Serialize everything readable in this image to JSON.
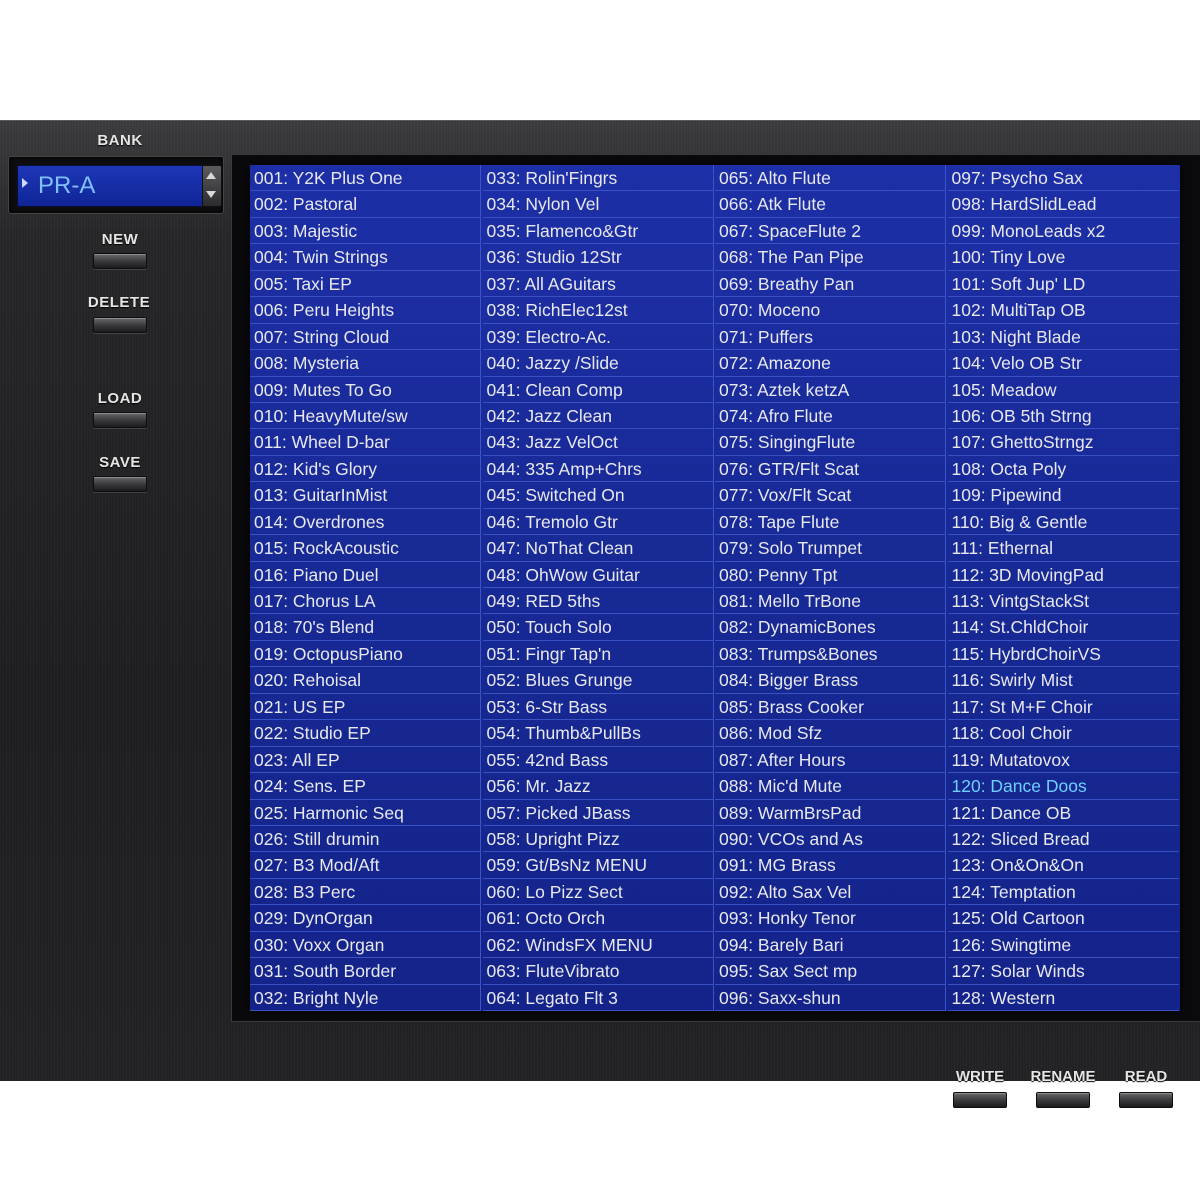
{
  "bank": {
    "label": "BANK",
    "value": "PR-A"
  },
  "side_buttons": {
    "new": "NEW",
    "delete": "DELETE",
    "load": "LOAD",
    "save": "SAVE"
  },
  "bottom_buttons": {
    "write": "WRITE",
    "rename": "RENAME",
    "read": "READ"
  },
  "selected_patch": "120: Dance Doos",
  "patches": [
    "001: Y2K Plus One",
    "002: Pastoral",
    "003: Majestic",
    "004: Twin Strings",
    "005: Taxi EP",
    "006: Peru Heights",
    "007: String Cloud",
    "008: Mysteria",
    "009: Mutes To Go",
    "010: HeavyMute/sw",
    "011: Wheel D-bar",
    "012: Kid's Glory",
    "013: GuitarInMist",
    "014: Overdrones",
    "015: RockAcoustic",
    "016: Piano Duel",
    "017: Chorus LA",
    "018: 70's Blend",
    "019: OctopusPiano",
    "020: Rehoisal",
    "021: US EP",
    "022: Studio EP",
    "023: All EP",
    "024: Sens. EP",
    "025: Harmonic Seq",
    "026: Still drumin",
    "027: B3 Mod/Aft",
    "028: B3 Perc",
    "029: DynOrgan",
    "030: Voxx Organ",
    "031: South Border",
    "032: Bright Nyle",
    "033: Rolin'Fingrs",
    "034: Nylon Vel",
    "035: Flamenco&Gtr",
    "036: Studio 12Str",
    "037: All AGuitars",
    "038: RichElec12st",
    "039: Electro-Ac.",
    "040: Jazzy /Slide",
    "041: Clean Comp",
    "042: Jazz Clean",
    "043: Jazz VelOct",
    "044: 335 Amp+Chrs",
    "045: Switched On",
    "046: Tremolo Gtr",
    "047: NoThat Clean",
    "048: OhWow Guitar",
    "049: RED 5ths",
    "050: Touch Solo",
    "051: Fingr Tap'n",
    "052: Blues Grunge",
    "053: 6-Str Bass",
    "054: Thumb&PullBs",
    "055: 42nd Bass",
    "056: Mr. Jazz",
    "057: Picked JBass",
    "058: Upright Pizz",
    "059: Gt/BsNz MENU",
    "060: Lo Pizz Sect",
    "061: Octo Orch",
    "062: WindsFX MENU",
    "063: FluteVibrato",
    "064: Legato Flt 3",
    "065: Alto Flute",
    "066: Atk Flute",
    "067: SpaceFlute 2",
    "068: The Pan Pipe",
    "069: Breathy Pan",
    "070: Moceno",
    "071: Puffers",
    "072: Amazone",
    "073: Aztek ketzA",
    "074: Afro Flute",
    "075: SingingFlute",
    "076: GTR/Flt Scat",
    "077: Vox/Flt Scat",
    "078: Tape Flute",
    "079: Solo Trumpet",
    "080: Penny Tpt",
    "081: Mello TrBone",
    "082: DynamicBones",
    "083: Trumps&Bones",
    "084: Bigger Brass",
    "085: Brass Cooker",
    "086: Mod Sfz",
    "087: After Hours",
    "088: Mic'd Mute",
    "089: WarmBrsPad",
    "090: VCOs and As",
    "091: MG Brass",
    "092: Alto Sax Vel",
    "093: Honky Tenor",
    "094: Barely Bari",
    "095: Sax Sect mp",
    "096: Saxx-shun",
    "097: Psycho Sax",
    "098: HardSlidLead",
    "099: MonoLeads x2",
    "100: Tiny Love",
    "101: Soft Jup' LD",
    "102: MultiTap OB",
    "103: Night Blade",
    "104: Velo OB Str",
    "105: Meadow",
    "106: OB 5th Strng",
    "107: GhettoStrngz",
    "108: Octa Poly",
    "109: Pipewind",
    "110: Big & Gentle",
    "111: Ethernal",
    "112: 3D MovingPad",
    "113: VintgStackSt",
    "114: St.ChldChoir",
    "115: HybrdChoirVS",
    "116: Swirly Mist",
    "117: St M+F Choir",
    "118: Cool Choir",
    "119: Mutatovox",
    "120: Dance Doos",
    "121: Dance OB",
    "122: Sliced Bread",
    "123: On&On&On",
    "124: Temptation",
    "125: Old Cartoon",
    "126: Swingtime",
    "127: Solar Winds",
    "128: Western"
  ]
}
